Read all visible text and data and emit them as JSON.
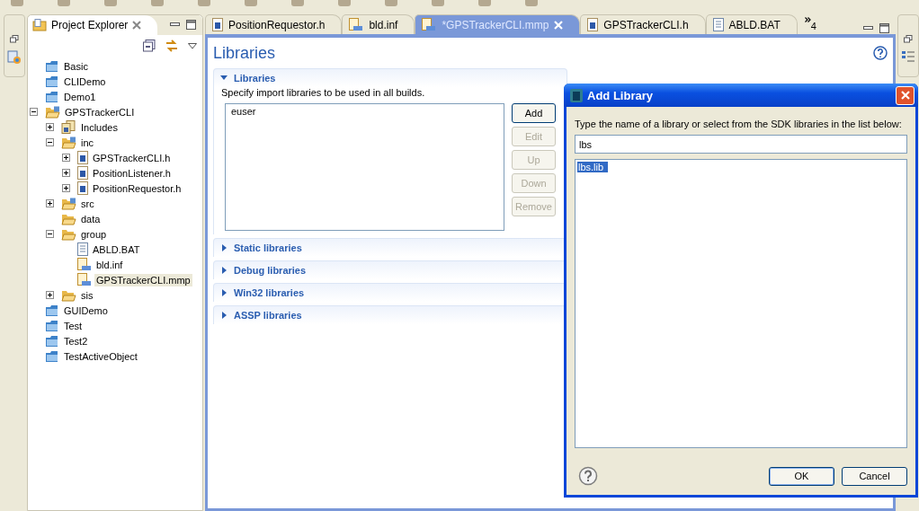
{
  "explorer": {
    "title": "Project Explorer",
    "tree": [
      {
        "label": "Basic",
        "kind": "project"
      },
      {
        "label": "CLIDemo",
        "kind": "project"
      },
      {
        "label": "Demo1",
        "kind": "project"
      },
      {
        "label": "GPSTrackerCLI",
        "kind": "cproject",
        "expanded": true,
        "children": [
          {
            "label": "Includes",
            "kind": "includes",
            "expanded": false
          },
          {
            "label": "inc",
            "kind": "cfolder",
            "expanded": true,
            "children": [
              {
                "label": "GPSTrackerCLI.h",
                "kind": "header",
                "expanded": false
              },
              {
                "label": "PositionListener.h",
                "kind": "header",
                "expanded": false
              },
              {
                "label": "PositionRequestor.h",
                "kind": "header",
                "expanded": false
              }
            ]
          },
          {
            "label": "src",
            "kind": "cfolder",
            "expanded": false
          },
          {
            "label": "data",
            "kind": "folder"
          },
          {
            "label": "group",
            "kind": "folder",
            "expanded": true,
            "children": [
              {
                "label": "ABLD.BAT",
                "kind": "text",
                "selected": false
              },
              {
                "label": "bld.inf",
                "kind": "build",
                "selected": false
              },
              {
                "label": "GPSTrackerCLI.mmp",
                "kind": "build",
                "selected": true
              }
            ]
          },
          {
            "label": "sis",
            "kind": "folder",
            "expanded": false
          }
        ]
      },
      {
        "label": "GUIDemo",
        "kind": "project"
      },
      {
        "label": "Test",
        "kind": "project"
      },
      {
        "label": "Test2",
        "kind": "project"
      },
      {
        "label": "TestActiveObject",
        "kind": "project"
      }
    ]
  },
  "tabs": [
    {
      "label": "PositionRequestor.h",
      "kind": "header",
      "selected": false
    },
    {
      "label": "bld.inf",
      "kind": "build",
      "selected": false
    },
    {
      "label": "*GPSTrackerCLI.mmp",
      "kind": "build",
      "selected": true
    },
    {
      "label": "GPSTrackerCLI.h",
      "kind": "header",
      "selected": false
    },
    {
      "label": "ABLD.BAT",
      "kind": "text",
      "selected": false
    }
  ],
  "more_tabs": "4",
  "editor": {
    "title": "Libraries",
    "sections": [
      {
        "title": "Libraries",
        "expanded": true,
        "description": "Specify import libraries to be used in all builds.",
        "items": [
          "euser"
        ],
        "buttons": [
          {
            "label": "Add",
            "disabled": false
          },
          {
            "label": "Edit",
            "disabled": true
          },
          {
            "label": "Up",
            "disabled": true
          },
          {
            "label": "Down",
            "disabled": true
          },
          {
            "label": "Remove",
            "disabled": true
          }
        ]
      },
      {
        "title": "Static libraries",
        "expanded": false
      },
      {
        "title": "Debug libraries",
        "expanded": false
      },
      {
        "title": "Win32 libraries",
        "expanded": false
      },
      {
        "title": "ASSP libraries",
        "expanded": false
      }
    ]
  },
  "dialog": {
    "title": "Add Library",
    "prompt": "Type the name of a library or select from the SDK libraries in the list below:",
    "value": "lbs",
    "results": [
      {
        "label": "lbs.lib",
        "selected": true
      }
    ],
    "buttons": [
      {
        "label": "OK",
        "default": true
      },
      {
        "label": "Cancel",
        "default": false
      }
    ]
  }
}
